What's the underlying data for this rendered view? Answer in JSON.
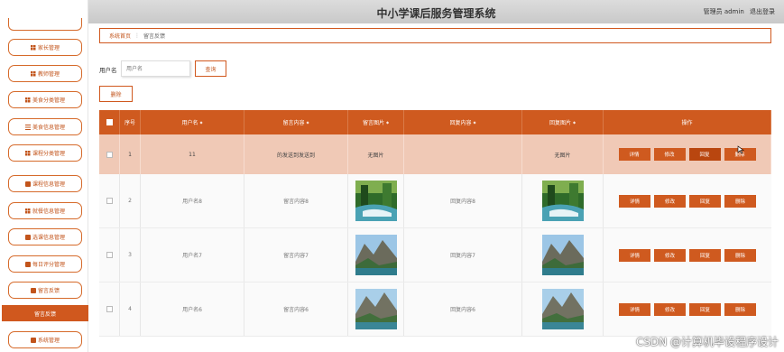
{
  "header": {
    "title": "中小学课后服务管理系统",
    "user_label": "管理员 admin",
    "logout": "退出登录"
  },
  "sidebar": {
    "items": [
      {
        "label": "家长管理",
        "icon": "grid-icon"
      },
      {
        "label": "教师管理",
        "icon": "grid-icon"
      },
      {
        "label": "美食分类管理",
        "icon": "grid-icon"
      },
      {
        "label": "美食信息管理",
        "icon": "list-icon"
      },
      {
        "label": "课程分类管理",
        "icon": "grid-icon"
      },
      {
        "label": "课程信息管理",
        "icon": "briefcase-icon"
      },
      {
        "label": "就餐信息管理",
        "icon": "grid-icon"
      },
      {
        "label": "选课信息管理",
        "icon": "cart-icon"
      },
      {
        "label": "每日评分管理",
        "icon": "chart-icon"
      },
      {
        "label": "留言反馈",
        "icon": "message-icon"
      },
      {
        "label": "留言反馈",
        "active": true
      },
      {
        "label": "系统管理",
        "icon": "settings-icon"
      }
    ]
  },
  "breadcrumb": {
    "home": "系统首页",
    "sep": "⋮",
    "current": "留言反馈"
  },
  "search": {
    "label": "用户名",
    "placeholder": "用户名",
    "button": "查询"
  },
  "delete_button": "删除",
  "table": {
    "headers": [
      "序号",
      "用户名",
      "留言内容",
      "留言图片",
      "回复内容",
      "回复图片",
      "操作"
    ],
    "rows": [
      {
        "no": "1",
        "username": "11",
        "content": "的发送到发送到",
        "image": "无图片",
        "reply": "",
        "reply_image": "无图片"
      },
      {
        "no": "2",
        "username": "用户名8",
        "content": "留言内容8",
        "image": "forest",
        "reply": "回复内容8",
        "reply_image": "forest"
      },
      {
        "no": "3",
        "username": "用户名7",
        "content": "留言内容7",
        "image": "mountain",
        "reply": "回复内容7",
        "reply_image": "mountain"
      },
      {
        "no": "4",
        "username": "用户名6",
        "content": "留言内容6",
        "image": "mountain",
        "reply": "回复内容6",
        "reply_image": "mountain"
      }
    ],
    "actions": {
      "detail": "详情",
      "edit": "修改",
      "reply": "回复",
      "delete": "删除"
    }
  },
  "watermark": "CSDN @计算机毕设程序设计",
  "colors": {
    "accent": "#cf5a1f",
    "highlight_row": "#f0c9b6"
  }
}
